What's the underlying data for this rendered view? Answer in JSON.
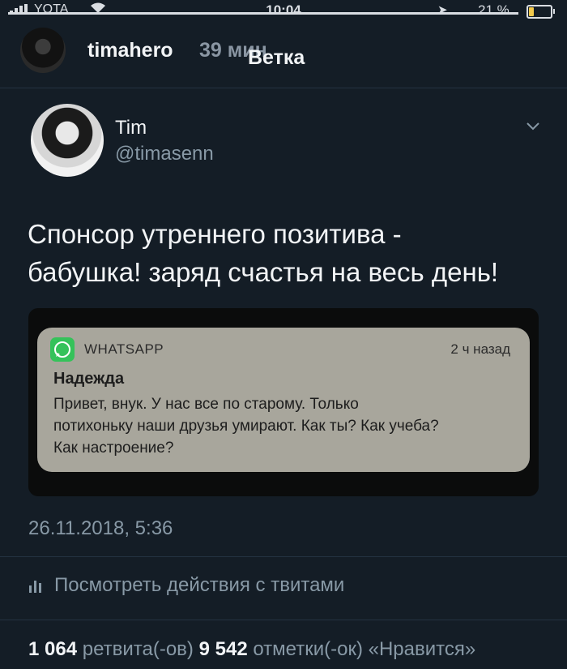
{
  "status_bar": {
    "carrier": "YOTA",
    "time": "10:04",
    "battery_percent": "21 %",
    "battery_level": 0.21
  },
  "story": {
    "username": "timahero",
    "time_ago": "39 мин",
    "title": "Ветка"
  },
  "tweet": {
    "author_name": "Tim",
    "author_handle": "@timasenn",
    "text_lines": [
      "Спонсор утреннего позитива -",
      "бабушка! заряд счастья на весь день!"
    ],
    "timestamp": "26.11.2018, 5:36",
    "activity_label": "Посмотреть действия с твитами",
    "retweets_count": "1 064",
    "retweets_label": "ретвита(-ов)",
    "likes_count": "9 542",
    "likes_label": "отметки(-ок) «Нравится»"
  },
  "notification": {
    "app": "WHATSAPP",
    "time": "2 ч назад",
    "sender": "Надежда",
    "message_lines": [
      "Привет, внук. У нас все по старому. Только",
      "потихоньку наши друзья умирают. Как ты? Как учеба?",
      "Как настроение?"
    ]
  },
  "colors": {
    "background": "#141d26",
    "secondary_text": "#8899a6",
    "notification_bg": "#a8a69c",
    "whatsapp_green": "#35c25a"
  },
  "icons": [
    "signal-icon",
    "wifi-icon",
    "location-icon",
    "battery-icon",
    "chevron-down-icon",
    "whatsapp-icon",
    "activity-chart-icon"
  ]
}
